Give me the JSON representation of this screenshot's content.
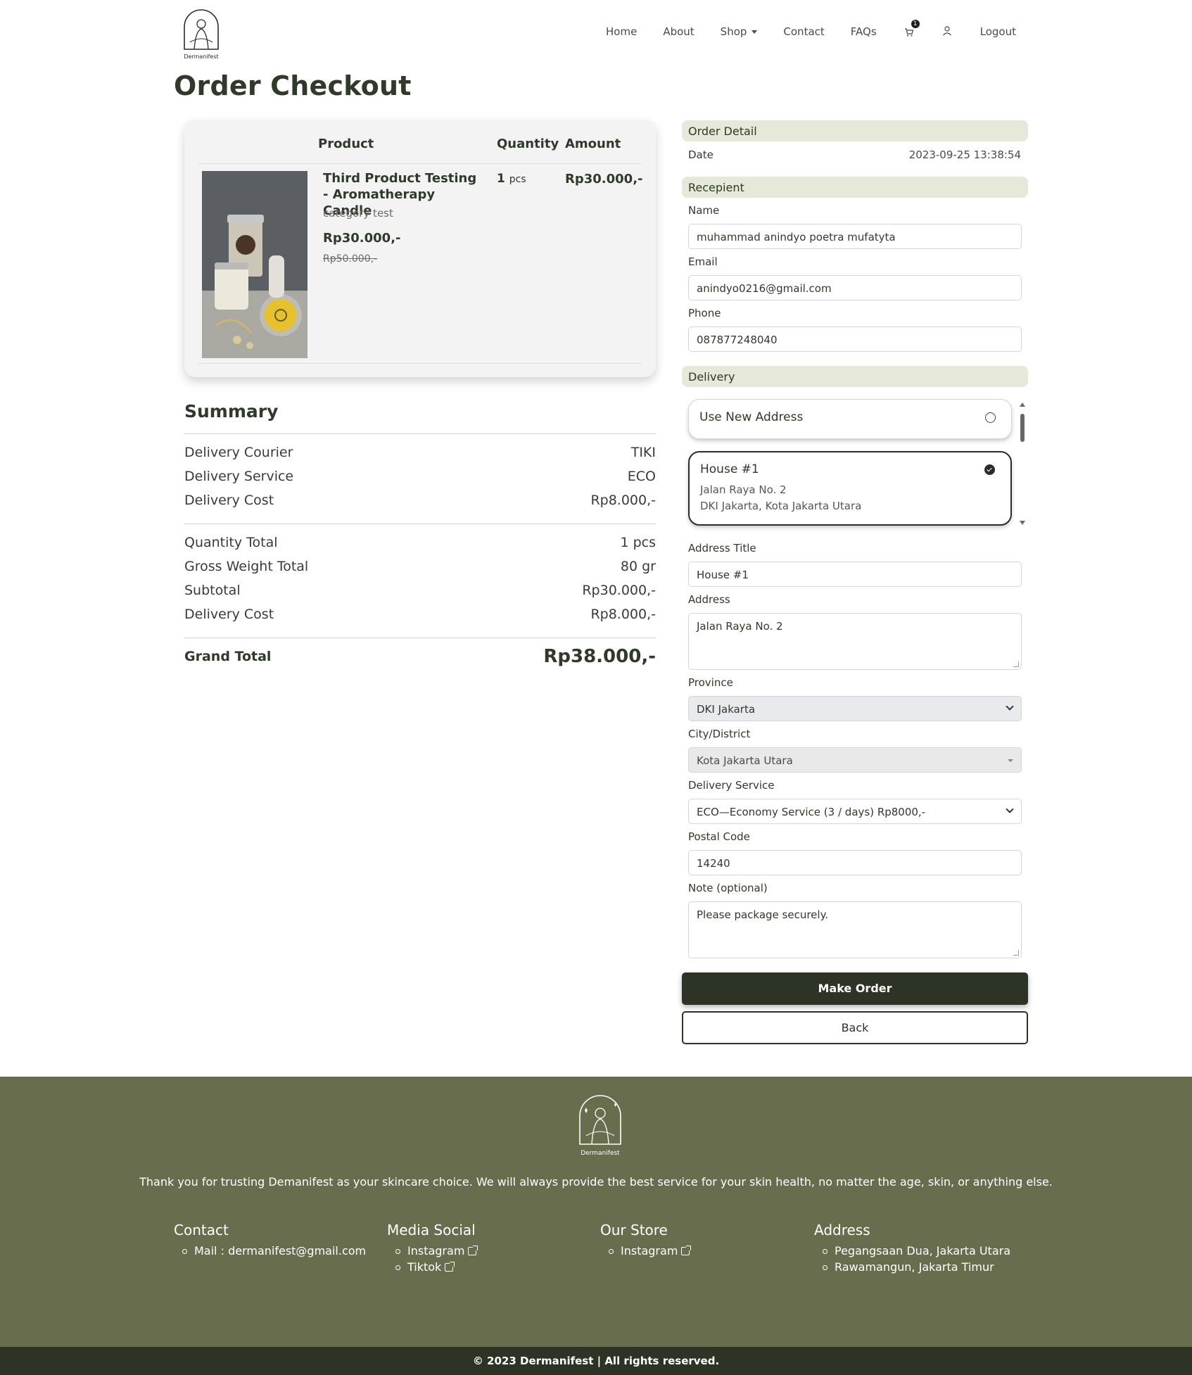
{
  "nav": {
    "brand": "Dermanifest",
    "links": {
      "home": "Home",
      "about": "About",
      "shop": "Shop",
      "contact": "Contact",
      "faqs": "FAQs",
      "logout": "Logout"
    },
    "cart_count": "1"
  },
  "page_title": "Order Checkout",
  "product_table": {
    "headers": {
      "product": "Product",
      "quantity": "Quantity",
      "amount": "Amount"
    },
    "item": {
      "name": "Third Product Testing - Aromatherapy Candle",
      "category": "category test",
      "price": "Rp30.000,-",
      "old_price": "Rp50.000,-",
      "quantity": "1",
      "quantity_unit": "pcs",
      "amount": "Rp30.000,-"
    }
  },
  "summary": {
    "title": "Summary",
    "rows1": [
      {
        "label": "Delivery Courier",
        "value": "TIKI"
      },
      {
        "label": "Delivery Service",
        "value": "ECO"
      },
      {
        "label": "Delivery Cost",
        "value": "Rp8.000,-"
      }
    ],
    "rows2": [
      {
        "label": "Quantity Total",
        "value": "1 pcs"
      },
      {
        "label": "Gross Weight Total",
        "value": "80 gr"
      },
      {
        "label": "Subtotal",
        "value": "Rp30.000,-"
      },
      {
        "label": "Delivery Cost",
        "value": "Rp8.000,-"
      }
    ],
    "grand_label": "Grand Total",
    "grand_value": "Rp38.000,-"
  },
  "order_detail": {
    "title": "Order Detail",
    "date_label": "Date",
    "date_value": "2023-09-25 13:38:54"
  },
  "recipient": {
    "title": "Recepient",
    "name_label": "Name",
    "name_value": "muhammad anindyo poetra mufatyta",
    "email_label": "Email",
    "email_value": "anindyo0216@gmail.com",
    "phone_label": "Phone",
    "phone_value": "087877248040"
  },
  "delivery": {
    "title": "Delivery",
    "new_address": "Use New Address",
    "saved_address": {
      "title": "House #1",
      "line1": "Jalan Raya No. 2",
      "line2": "DKI Jakarta, Kota Jakarta Utara"
    },
    "address_title_label": "Address Title",
    "address_title_value": "House #1",
    "address_label": "Address",
    "address_value": "Jalan Raya No. 2",
    "province_label": "Province",
    "province_value": "DKI Jakarta",
    "city_label": "City/District",
    "city_value": "Kota Jakarta Utara",
    "service_label": "Delivery Service",
    "service_value": "ECO—Economy Service (3 / days) Rp8000,-",
    "postal_label": "Postal Code",
    "postal_value": "14240",
    "note_label": "Note (optional)",
    "note_value": "Please package securely."
  },
  "buttons": {
    "make_order": "Make Order",
    "back": "Back"
  },
  "footer": {
    "brand": "Dermanifest",
    "tagline": "Thank you for trusting Demanifest as your skincare choice. We will always provide the best service for your skin health, no matter the age, skin, or anything else.",
    "contact": {
      "title": "Contact",
      "items": [
        "Mail : dermanifest@gmail.com"
      ]
    },
    "media": {
      "title": "Media Social",
      "items": [
        "Instagram",
        "Tiktok"
      ]
    },
    "store": {
      "title": "Our Store",
      "items": [
        "Instagram"
      ]
    },
    "address": {
      "title": "Address",
      "items": [
        "Pegangsaan Dua, Jakarta Utara",
        "Rawamangun, Jakarta Timur"
      ]
    },
    "copyright": "© 2023 Dermanifest | All rights reserved."
  },
  "colors": {
    "accent_dark": "#2d3325",
    "footer_bg": "#686d4d",
    "section_header_bg": "#e6e8da"
  }
}
